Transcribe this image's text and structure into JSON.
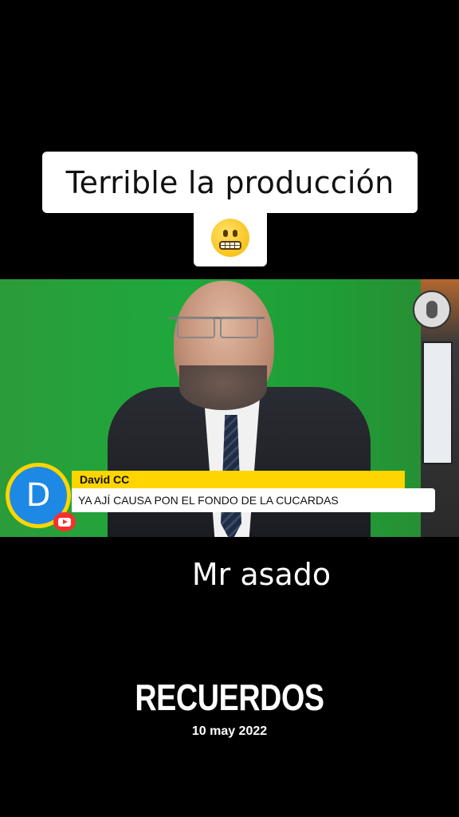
{
  "caption": {
    "text": "Terrible la producción",
    "emoji": "grimacing-face-emoji"
  },
  "video": {
    "logo_icon": "microphone-logo-icon",
    "comment": {
      "avatar_letter": "D",
      "platform_icon": "youtube-icon",
      "author": "David CC",
      "message": "YA AJÍ CAUSA PON EL FONDO DE LA CUCARDAS"
    }
  },
  "overlay": {
    "name": "Mr asado",
    "title": "RECUERDOS",
    "date": "10 may 2022"
  },
  "colors": {
    "background": "#000000",
    "caption_bg": "#ffffff",
    "name_bar": "#ffd500",
    "avatar_blue": "#1e88e5",
    "youtube_red": "#ff2d2d"
  }
}
